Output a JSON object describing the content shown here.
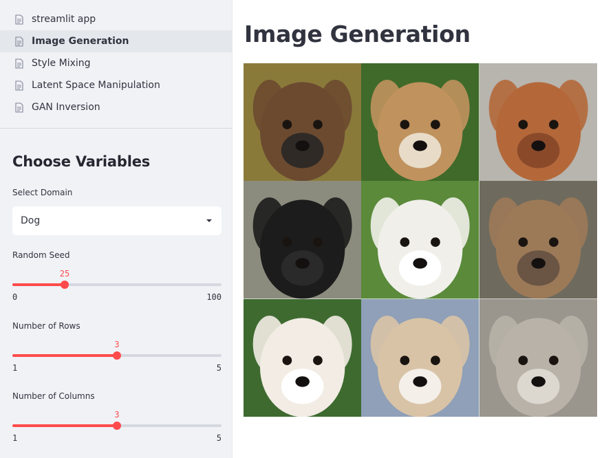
{
  "sidebar": {
    "nav": [
      {
        "label": "streamlit app",
        "active": false
      },
      {
        "label": "Image Generation",
        "active": true
      },
      {
        "label": "Style Mixing",
        "active": false
      },
      {
        "label": "Latent Space Manipulation",
        "active": false
      },
      {
        "label": "GAN Inversion",
        "active": false
      }
    ],
    "section_title": "Choose Variables",
    "domain": {
      "label": "Select Domain",
      "value": "Dog"
    },
    "seed": {
      "label": "Random Seed",
      "value": 25,
      "value_text": "25",
      "min": 0,
      "max": 100,
      "min_text": "0",
      "max_text": "100"
    },
    "rows": {
      "label": "Number of Rows",
      "value": 3,
      "value_text": "3",
      "min": 1,
      "max": 5,
      "min_text": "1",
      "max_text": "5"
    },
    "cols": {
      "label": "Number of Columns",
      "value": 3,
      "value_text": "3",
      "min": 1,
      "max": 5,
      "min_text": "1",
      "max_text": "5"
    }
  },
  "main": {
    "title": "Image Generation",
    "images": [
      {
        "name": "dog-image-1",
        "fur": "#6b4a30",
        "bg": "#8a7a3a",
        "muzzle": "#2f2a26"
      },
      {
        "name": "dog-image-2",
        "fur": "#c0925e",
        "bg": "#3f6a2a",
        "muzzle": "#e8dcc8"
      },
      {
        "name": "dog-image-3",
        "fur": "#b4683a",
        "bg": "#b8b4ae",
        "muzzle": "#8a4a2a"
      },
      {
        "name": "dog-image-4",
        "fur": "#1c1c1c",
        "bg": "#8c8c7e",
        "muzzle": "#2a2a2a"
      },
      {
        "name": "dog-image-5",
        "fur": "#f0efea",
        "bg": "#5a8a3a",
        "muzzle": "#ffffff"
      },
      {
        "name": "dog-image-6",
        "fur": "#9c7a58",
        "bg": "#6e6a5e",
        "muzzle": "#6a5443"
      },
      {
        "name": "dog-image-7",
        "fur": "#f2ece4",
        "bg": "#3e6a30",
        "muzzle": "#ffffff"
      },
      {
        "name": "dog-image-8",
        "fur": "#d9c3a6",
        "bg": "#8fa0b8",
        "muzzle": "#f4efe8"
      },
      {
        "name": "dog-image-9",
        "fur": "#b8b2a8",
        "bg": "#9a968e",
        "muzzle": "#dcd8d0"
      }
    ]
  }
}
